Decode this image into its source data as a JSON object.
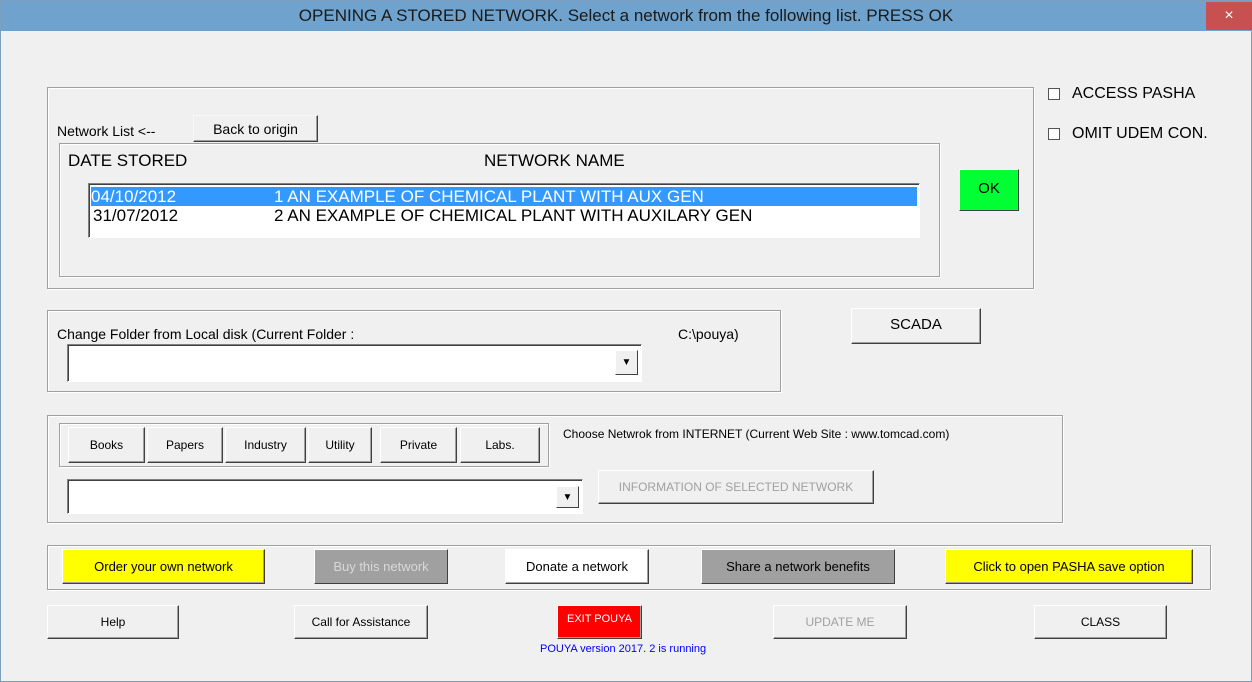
{
  "window": {
    "title": "OPENING A STORED NETWORK.   Select a network from the following list.   PRESS OK",
    "close_glyph": "×"
  },
  "network_list": {
    "label": "Network List  <--",
    "back_button": "Back to origin",
    "col_date": "DATE STORED",
    "col_name": "NETWORK NAME",
    "rows": [
      {
        "date": "04/10/2012",
        "name": "1  AN EXAMPLE OF CHEMICAL PLANT WITH AUX GEN",
        "selected": true
      },
      {
        "date": "31/07/2012",
        "name": "2  AN EXAMPLE OF CHEMICAL PLANT WITH AUXILARY GEN",
        "selected": false
      }
    ]
  },
  "ok_button": "OK",
  "checkboxes": {
    "access_pasha": "ACCESS PASHA",
    "omit_udem": "OMIT UDEM CON."
  },
  "local_folder": {
    "label": "Change Folder from Local disk  (Current Folder :",
    "path": "C:\\pouya)",
    "value": ""
  },
  "scada_button": "SCADA",
  "internet": {
    "tabs": [
      "Books",
      "Papers",
      "Industry",
      "Utility",
      "Private",
      "Labs."
    ],
    "label": "Choose Netwrok from INTERNET   (Current Web Site : www.tomcad.com)",
    "value": "",
    "info_button": "INFORMATION OF SELECTED NETWORK"
  },
  "actions": {
    "order": "Order your own network",
    "buy": "Buy this network",
    "donate": "Donate a network",
    "share": "Share a network benefits",
    "pasha_save": "Click to open PASHA save option"
  },
  "bottom": {
    "help": "Help",
    "assist": "Call for Assistance",
    "exit": "EXIT POUYA",
    "update": "UPDATE ME",
    "class": "CLASS",
    "version": "POUYA version 2017. 2 is running"
  },
  "colors": {
    "ok": "#00ff33",
    "exit": "#ff0000",
    "yellow": "#ffff00",
    "gray_btn": "#a0a0a0",
    "selection": "#3399ff",
    "version_text": "#0000ff"
  }
}
